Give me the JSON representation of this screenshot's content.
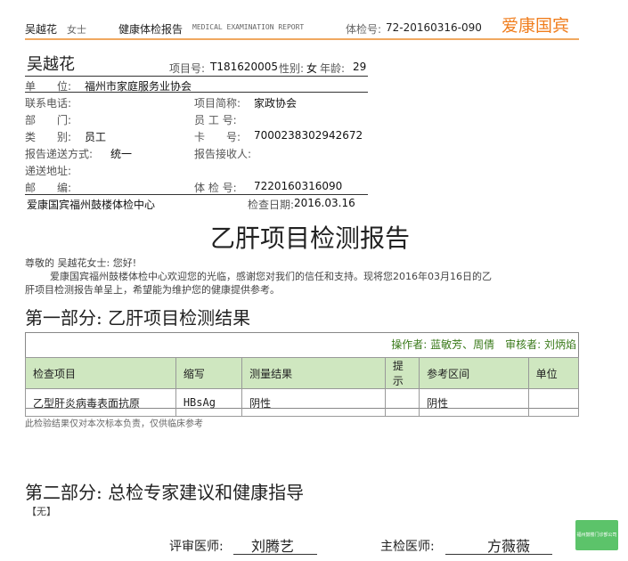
{
  "header": {
    "name": "吴越花",
    "title_honorific": "女士",
    "report_title": "健康体检报告",
    "report_title_en": "MEDICAL EXAMINATION REPORT",
    "exam_no_label": "体检号:",
    "exam_no": "72-20160316-090",
    "brand": "爱康国宾"
  },
  "info": {
    "name": "吴越花",
    "project_no_label": "项目号:",
    "project_no": "T181620005",
    "gender_label": "性别:",
    "gender": "女",
    "age_label": "年龄:",
    "age": "29",
    "unit_label": "单　　位:",
    "unit": "福州市家庭服务业协会",
    "phone_label": "联系电话:",
    "project_abbr_label": "项目简称:",
    "project_abbr": "家政协会",
    "dept_label": "部　　门:",
    "employee_no_label": "员 工 号:",
    "category_label": "类　　别:",
    "category": "员工",
    "card_label": "卡　　号:",
    "card": "7000238302942672",
    "delivery_label": "报告递送方式:",
    "delivery": "统一",
    "receiver_label": "报告接收人:",
    "address_label": "递送地址:",
    "postcode_label": "邮　　编:",
    "exam_no2_label": "体 检 号:",
    "exam_no2": "7220160316090",
    "center": "爱康国宾福州鼓楼体检中心",
    "date_label": "检查日期:",
    "date": "2016.03.16"
  },
  "main_title": "乙肝项目检测报告",
  "greeting": "尊敬的 吴越花女士: 您好!",
  "intro_line1": "爱康国宾福州鼓楼体检中心欢迎您的光临，感谢您对我们的信任和支持。现将您2016年03月16日的乙",
  "intro_line2": "肝项目检测报告单呈上，希望能为维护您的健康提供参考。",
  "section1": {
    "title": "第一部分: 乙肝项目检测结果",
    "operators": "操作者: 蓝敏芳、周倩　审核者: 刘炳焰",
    "headers": [
      "检查项目",
      "缩写",
      "测量结果",
      "提示",
      "参考区间",
      "单位"
    ],
    "rows": [
      [
        "乙型肝炎病毒表面抗原",
        "HBsAg",
        "阴性",
        "",
        "阴性",
        ""
      ]
    ],
    "note": "此检验结果仅对本次标本负责，仅供临床参考"
  },
  "section2": {
    "title": "第二部分: 总检专家建议和健康指导",
    "content": "【无】"
  },
  "signatures": {
    "reviewer_label": "评审医师:",
    "reviewer": "刘腾艺",
    "chief_label": "主检医师:",
    "chief": "方薇薇"
  },
  "stamp_text": "福州鼓楼门诊部公司"
}
